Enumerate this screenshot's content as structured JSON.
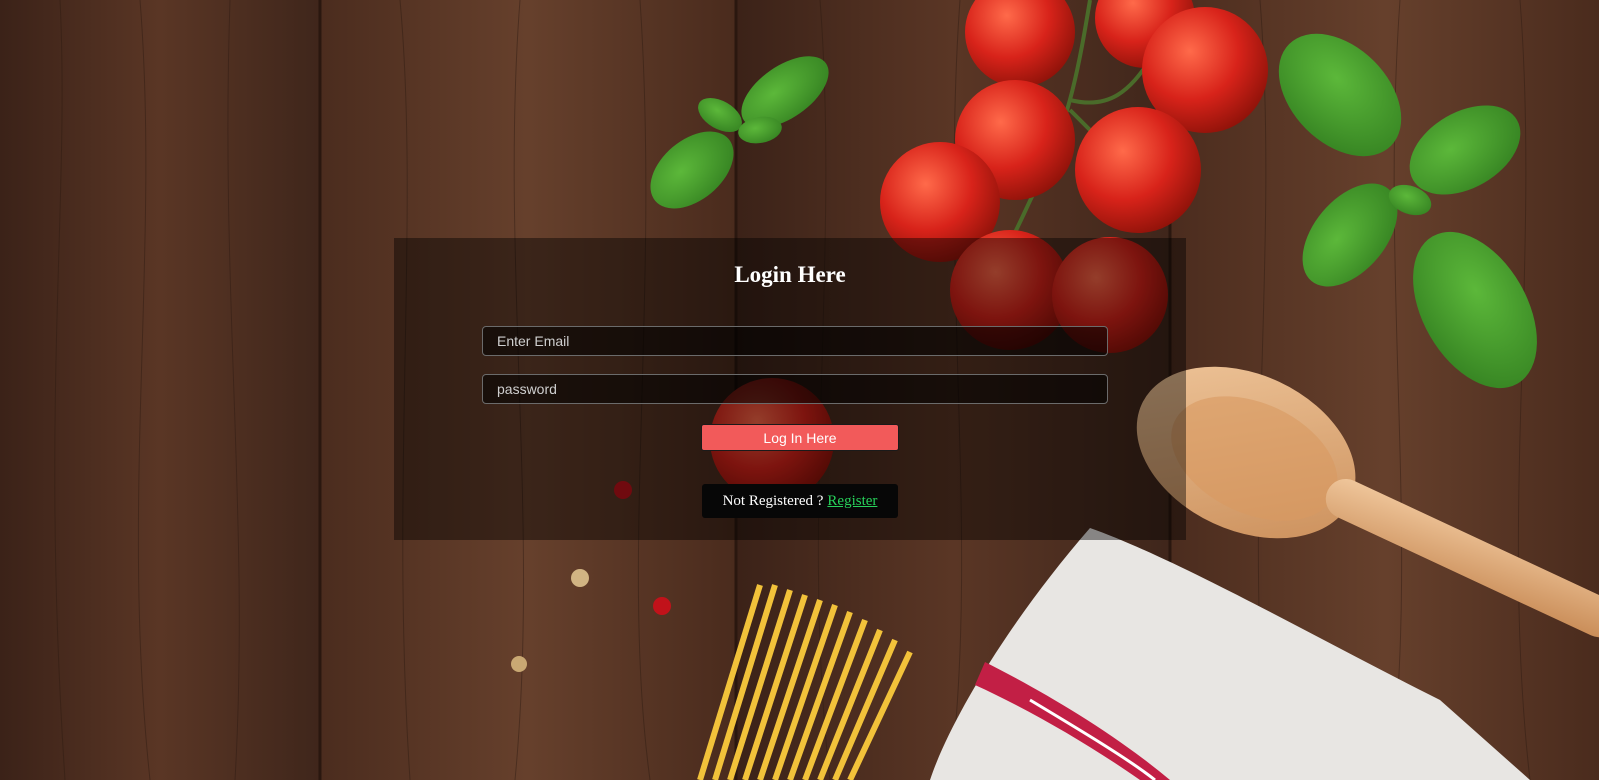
{
  "page": {
    "title": "Login Here"
  },
  "form": {
    "email_placeholder": "Enter Email",
    "password_placeholder": "password",
    "login_button_label": "Log In Here",
    "not_registered_text": "Not Registered ?",
    "register_link_label": "Register"
  },
  "colors": {
    "button": "#f25a5a",
    "register_link": "#27d15a",
    "panel_overlay": "rgba(0,0,0,0.42)"
  }
}
